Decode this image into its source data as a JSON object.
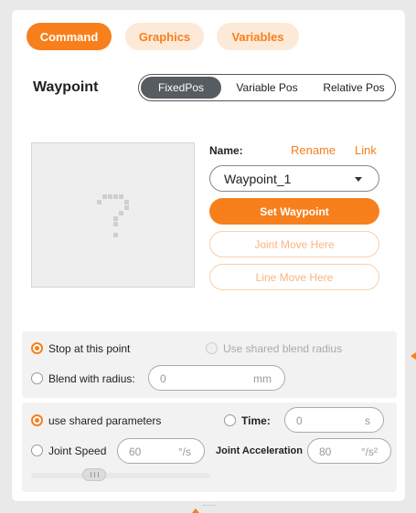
{
  "tabs": [
    {
      "label": "Command",
      "active": true
    },
    {
      "label": "Graphics",
      "active": false
    },
    {
      "label": "Variables",
      "active": false
    }
  ],
  "waypoint": {
    "title": "Waypoint",
    "position_modes": [
      "FixedPos",
      "Variable Pos",
      "Relative Pos"
    ],
    "selected_mode": "FixedPos",
    "name_label": "Name:",
    "rename_label": "Rename",
    "link_label": "Link",
    "selected_name": "Waypoint_1",
    "set_button": "Set Waypoint",
    "joint_move_button": "Joint Move Here",
    "line_move_button": "Line Move Here"
  },
  "blend": {
    "stop_label": "Stop at this point",
    "stop_selected": true,
    "shared_blend_label": "Use shared blend radius",
    "shared_blend_enabled": false,
    "blend_radius_label": "Blend with radius:",
    "blend_radius_value": "0",
    "blend_radius_unit": "mm"
  },
  "params": {
    "shared_label": "use shared parameters",
    "shared_selected": true,
    "time_label": "Time:",
    "time_value": "0",
    "time_unit": "s",
    "joint_speed_label": "Joint Speed",
    "joint_speed_value": "60",
    "joint_speed_unit": "°/s",
    "joint_accel_label": "Joint Acceleration",
    "joint_accel_value": "80",
    "joint_accel_unit": "°/s²",
    "speed_slider_fraction": 0.35
  },
  "colors": {
    "accent": "#f77f1c",
    "accent_light": "#fde9d7",
    "segment_active": "#575c61"
  }
}
